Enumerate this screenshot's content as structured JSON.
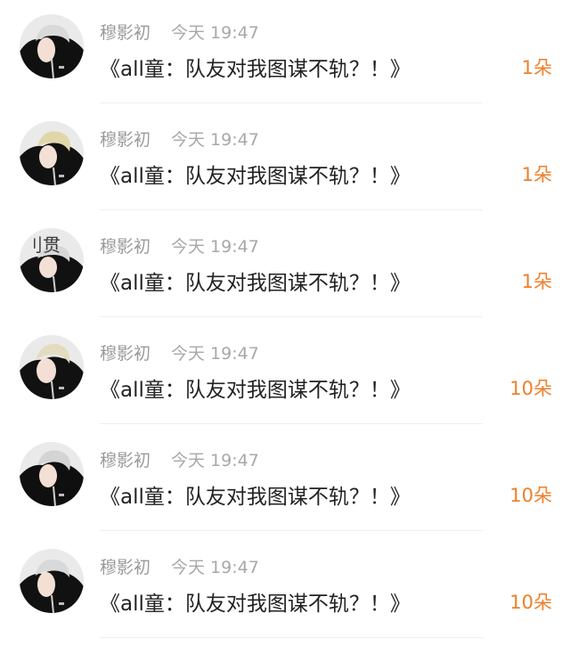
{
  "feed": {
    "items": [
      {
        "username": "穆影初",
        "time": "今天 19:47",
        "title": "《all童：队友对我图谋不轨？！》",
        "count": "1朵",
        "avatar_icon": "avatar-person-icon",
        "avatar_overlay_text": ""
      },
      {
        "username": "穆影初",
        "time": "今天 19:47",
        "title": "《all童：队友对我图谋不轨？！》",
        "count": "1朵",
        "avatar_icon": "avatar-person-icon",
        "avatar_overlay_text": ""
      },
      {
        "username": "穆影初",
        "time": "今天 19:47",
        "title": "《all童：队友对我图谋不轨？！》",
        "count": "1朵",
        "avatar_icon": "avatar-person-icon",
        "avatar_overlay_text": "刂贯"
      },
      {
        "username": "穆影初",
        "time": "今天 19:47",
        "title": "《all童：队友对我图谋不轨？！》",
        "count": "10朵",
        "avatar_icon": "avatar-person-icon",
        "avatar_overlay_text": ""
      },
      {
        "username": "穆影初",
        "time": "今天 19:47",
        "title": "《all童：队友对我图谋不轨？！》",
        "count": "10朵",
        "avatar_icon": "avatar-person-icon",
        "avatar_overlay_text": ""
      },
      {
        "username": "穆影初",
        "time": "今天 19:47",
        "title": "《all童：队友对我图谋不轨？！》",
        "count": "10朵",
        "avatar_icon": "avatar-person-icon",
        "avatar_overlay_text": ""
      }
    ]
  },
  "colors": {
    "username": "#9a9a9a",
    "time": "#a8a8a8",
    "title": "#222222",
    "count": "#f07f2a",
    "divider": "#f0f0f0"
  }
}
